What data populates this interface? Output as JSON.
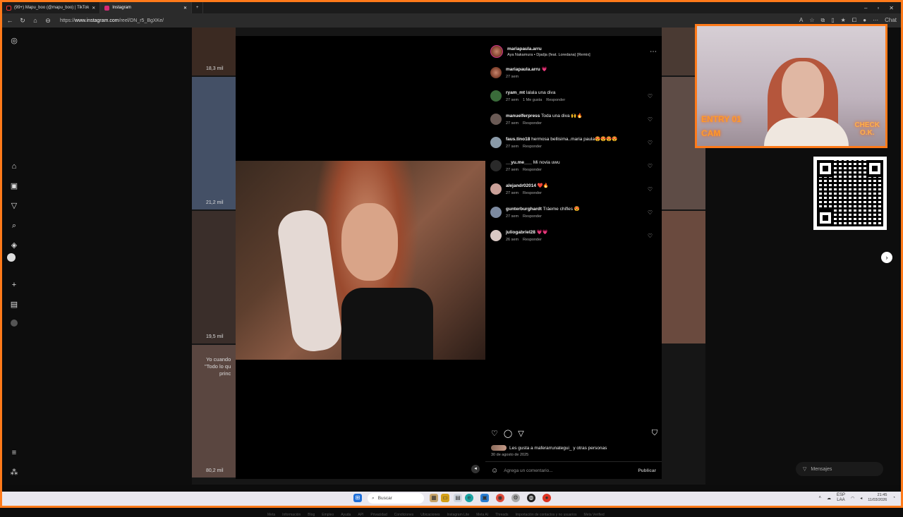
{
  "browser": {
    "tabs": [
      {
        "label": "(99+) Mapu_boo (@mapu_boo) | TikTok",
        "active": false
      },
      {
        "label": "Instagram",
        "active": true
      }
    ],
    "new_tab": "+",
    "url_prefix": "https://",
    "url_host": "www.instagram.com",
    "url_path": "/reel/DN_r5_BgXKe/",
    "chat_label": "Chat"
  },
  "feed": {
    "view_counts": [
      "18,3 mil",
      "21,2 mil",
      "19,5 mil",
      "80,2 mil"
    ],
    "caption_snippet": [
      "Yo cuando",
      "\"Todo lo qu",
      "princ"
    ]
  },
  "post": {
    "author": "mariapaula.arru",
    "song": "Aya Nakamura • Djadja (feat. Loredana) [Remix]",
    "caption": {
      "user": "mariapaula.arru",
      "text": "💗",
      "time": "27 sem"
    },
    "comments": [
      {
        "user": "ryam_mt",
        "text": "lalala una diva",
        "time": "27 sem",
        "likes": "1 Me gusta",
        "reply": "Responder"
      },
      {
        "user": "manuelferpress",
        "text": "Toda una diva 🙌🔥",
        "time": "27 sem",
        "likes": "",
        "reply": "Responder"
      },
      {
        "user": "faus.tino18",
        "text": "hermosa bellisima..maria paula😍😍😍😍",
        "time": "27 sem",
        "likes": "",
        "reply": "Responder"
      },
      {
        "user": "__yu.me___",
        "text": "Mi novia uwu",
        "time": "27 sem",
        "likes": "",
        "reply": "Responder"
      },
      {
        "user": "alejandr02014",
        "text": "❤️🔥",
        "time": "27 sem",
        "likes": "",
        "reply": "Responder"
      },
      {
        "user": "gunterburghardt",
        "text": "Tráeme chifles 😍",
        "time": "27 sem",
        "likes": "",
        "reply": "Responder"
      },
      {
        "user": "juliogabriel28",
        "text": "💗💗",
        "time": "26 sem",
        "likes": "",
        "reply": "Responder"
      }
    ],
    "likes_text": "Les gusta a maferarrunategui_ y otras personas",
    "date": "30 de agosto de 2025",
    "add_comment_placeholder": "Agrega un comentario...",
    "publish_label": "Publicar"
  },
  "overlay": {
    "neon_left_1": "ENTRY 01",
    "neon_left_2": "CAM",
    "neon_right_1": "CHECK",
    "neon_right_2": "O.K."
  },
  "messages_label": "Mensajes",
  "footer_links": [
    "Meta",
    "Información",
    "Blog",
    "Empleo",
    "Ayuda",
    "API",
    "Privacidad",
    "Condiciones",
    "Ubicaciones",
    "Instagram Lite",
    "Meta AI",
    "Threads",
    "Importación de contactos y no usuarios",
    "Meta Verified"
  ],
  "taskbar": {
    "search_placeholder": "Buscar",
    "lang": "ESP",
    "lang2": "LAA",
    "time": "21:45",
    "date": "11/03/2026"
  },
  "icons": {
    "home": "home-icon",
    "reels": "reels-icon",
    "messages": "send-icon",
    "search": "search-icon",
    "explore": "compass-icon",
    "notifications": "heart-icon",
    "create": "plus-icon",
    "dashboard": "chart-icon"
  },
  "colors": {
    "accent_frame": "#ff7a1a",
    "panel_bg": "#000000",
    "page_bg": "#0d0d0d"
  }
}
